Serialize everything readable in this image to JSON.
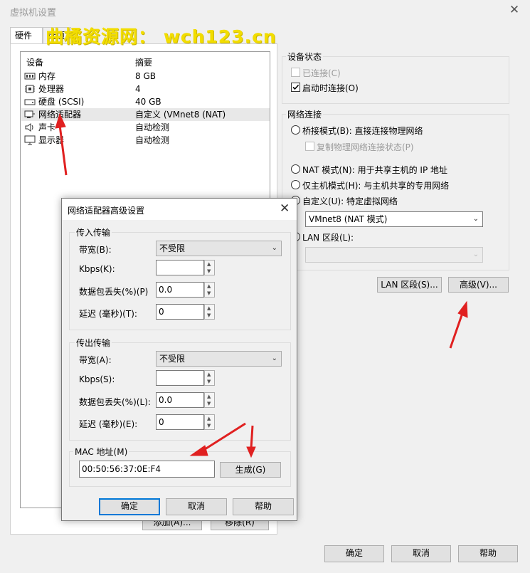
{
  "window": {
    "title": "虚拟机设置",
    "close": "✕",
    "watermark": "曲橘资源网： wch123.cn"
  },
  "tabs": [
    {
      "label": "硬件"
    },
    {
      "label": "选项"
    }
  ],
  "device_table": {
    "headers": {
      "device": "设备",
      "summary": "摘要"
    },
    "rows": [
      {
        "name": "内存",
        "summary": "8 GB",
        "icon": "memory-icon"
      },
      {
        "name": "处理器",
        "summary": "4",
        "icon": "cpu-icon"
      },
      {
        "name": "硬盘 (SCSI)",
        "summary": "40 GB",
        "icon": "hard-disk-icon"
      },
      {
        "name": "网络适配器",
        "summary": "自定义 (VMnet8 (NAT)",
        "icon": "network-adapter-icon"
      },
      {
        "name": "声卡",
        "summary": "自动检测",
        "icon": "speaker-icon"
      },
      {
        "name": "显示器",
        "summary": "自动检测",
        "icon": "monitor-icon"
      }
    ],
    "add_label": "添加(A)...",
    "remove_label": "移除(R)"
  },
  "device_status": {
    "title": "设备状态",
    "connected": "已连接(C)",
    "connect_at_power_on": "启动时连接(O)"
  },
  "network_connection": {
    "title": "网络连接",
    "bridged": "桥接模式(B): 直接连接物理网络",
    "replicate": "复制物理网络连接状态(P)",
    "nat": "NAT 模式(N): 用于共享主机的 IP 地址",
    "host_only": "仅主机模式(H): 与主机共享的专用网络",
    "custom": "自定义(U): 特定虚拟网络",
    "custom_value": "VMnet8 (NAT 模式)",
    "lan_segment": "LAN 区段(L):",
    "lan_segments_button": "LAN 区段(S)...",
    "advanced_button": "高级(V)..."
  },
  "main_buttons": {
    "ok": "确定",
    "cancel": "取消",
    "help": "帮助"
  },
  "dialog": {
    "title": "网络适配器高级设置",
    "close": "✕",
    "incoming": {
      "title": "传入传输",
      "bandwidth_label": "带宽(B):",
      "bandwidth_value": "不受限",
      "kbps_label": "Kbps(K):",
      "kbps_value": "",
      "loss_label": "数据包丢失(%)(P)",
      "loss_value": "0.0",
      "latency_label": "延迟 (毫秒)(T):",
      "latency_value": "0"
    },
    "outgoing": {
      "title": "传出传输",
      "bandwidth_label": "带宽(A):",
      "bandwidth_value": "不受限",
      "kbps_label": "Kbps(S):",
      "kbps_value": "",
      "loss_label": "数据包丢失(%)(L):",
      "loss_value": "0.0",
      "latency_label": "延迟 (毫秒)(E):",
      "latency_value": "0"
    },
    "mac": {
      "title": "MAC 地址(M)",
      "value": "00:50:56:37:0E:F4",
      "generate": "生成(G)"
    },
    "buttons": {
      "ok": "确定",
      "cancel": "取消",
      "help": "帮助"
    }
  },
  "colors": {
    "accent": "#0078d7",
    "annotation": "#e02020",
    "watermark": "#f2dd00"
  }
}
